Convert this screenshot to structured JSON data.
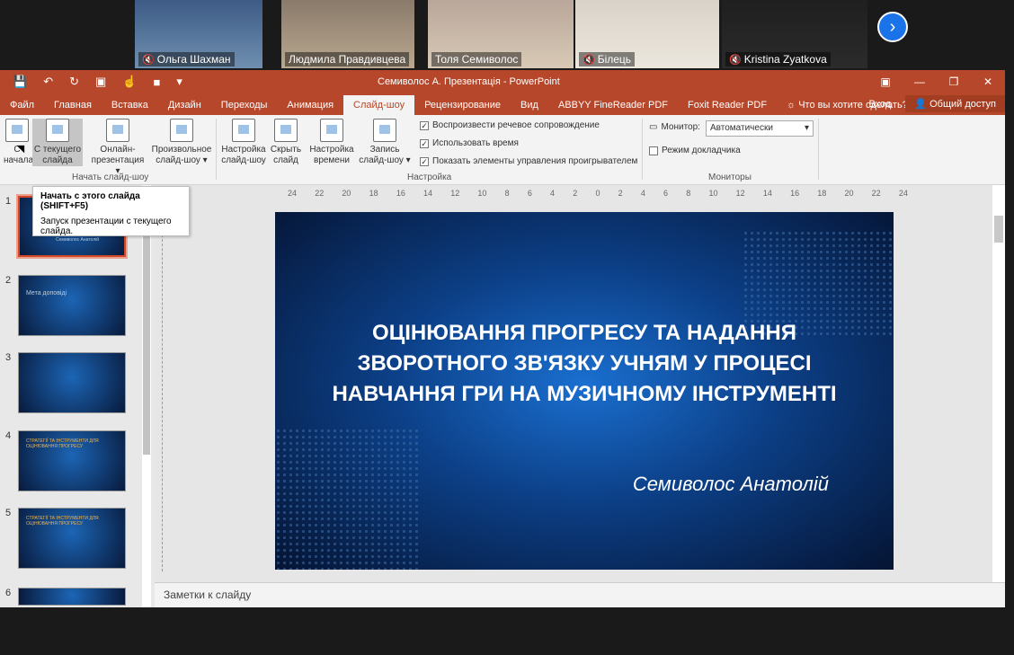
{
  "participants": [
    {
      "name": "Ольга Шахман",
      "muted": true,
      "active": false
    },
    {
      "name": "Людмила Правдивцева",
      "muted": false,
      "active": false
    },
    {
      "name": "Толя Семиволос",
      "muted": false,
      "active": true
    },
    {
      "name": "Білець",
      "muted": true,
      "active": false
    },
    {
      "name": "Kristina Zyatkova",
      "muted": true,
      "active": false
    }
  ],
  "window": {
    "title": "Семиволос А. Презентація - PowerPoint",
    "tabs": [
      "Файл",
      "Главная",
      "Вставка",
      "Дизайн",
      "Переходы",
      "Анимация",
      "Слайд-шоу",
      "Рецензирование",
      "Вид",
      "ABBYY FineReader PDF",
      "Foxit Reader PDF"
    ],
    "active_tab": "Слайд-шоу",
    "tell_me": "Что вы хотите сделать?",
    "sign_in": "Вход",
    "share": "Общий доступ"
  },
  "ribbon": {
    "from_start": "С начала",
    "from_current": "С текущего слайда",
    "online": "Онлайн-презентация ▾",
    "custom": "Произвольное слайд-шоу ▾",
    "group_start": "Начать слайд-шоу",
    "setup": "Настройка слайд-шоу",
    "hide": "Скрыть слайд",
    "rehearse": "Настройка времени",
    "record": "Запись слайд-шоу ▾",
    "chk1": "Воспроизвести речевое сопровождение",
    "chk2": "Использовать время",
    "chk3": "Показать элементы управления проигрывателем",
    "group_setup": "Настройка",
    "monitor_label": "Монитор:",
    "monitor_value": "Автоматически",
    "presenter_view": "Режим докладчика",
    "group_monitors": "Мониторы"
  },
  "tooltip": {
    "title": "Начать с этого слайда (SHIFT+F5)",
    "body": "Запуск презентации с текущего слайда."
  },
  "slides": [
    {
      "num": "1",
      "text": "Семиволос Анатолій"
    },
    {
      "num": "2",
      "text": "Мета доповіді"
    },
    {
      "num": "3",
      "text": ""
    },
    {
      "num": "4",
      "text": "СТРАТЕГІЇ ТА ІНСТРУМЕНТИ ДЛЯ ОЦІНЮВАННЯ ПРОГРЕСУ"
    },
    {
      "num": "5",
      "text": "СТРАТЕГІЇ ТА ІНСТРУМЕНТИ ДЛЯ ОЦІНЮВАННЯ ПРОГРЕСУ"
    },
    {
      "num": "6",
      "text": ""
    }
  ],
  "ruler_ticks": [
    "24",
    "22",
    "20",
    "18",
    "16",
    "14",
    "12",
    "10",
    "8",
    "6",
    "4",
    "2",
    "0",
    "2",
    "4",
    "6",
    "8",
    "10",
    "12",
    "14",
    "16",
    "18",
    "20",
    "22",
    "24"
  ],
  "slide": {
    "title": "ОЦІНЮВАННЯ ПРОГРЕСУ ТА НАДАННЯ ЗВОРОТНОГО ЗВ'ЯЗКУ УЧНЯМ У ПРОЦЕСІ НАВЧАННЯ ГРИ НА МУЗИЧНОМУ ІНСТРУМЕНТІ",
    "author": "Семиволос Анатолій"
  },
  "notes_placeholder": "Заметки к слайду"
}
